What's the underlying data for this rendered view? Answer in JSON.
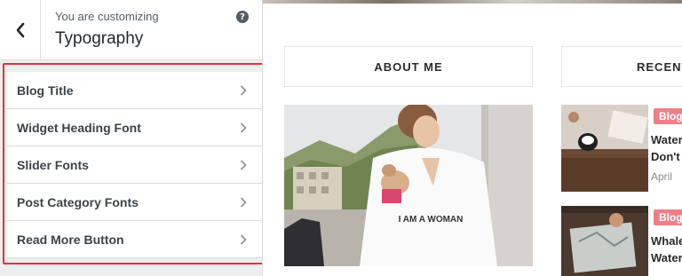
{
  "sidebar": {
    "customizing_label": "You are customizing",
    "section_title": "Typography",
    "help_symbol": "?",
    "items": [
      {
        "label": "Blog Title"
      },
      {
        "label": "Widget Heading Font"
      },
      {
        "label": "Slider Fonts"
      },
      {
        "label": "Post Category Fonts"
      },
      {
        "label": "Read More Button"
      }
    ]
  },
  "preview": {
    "about_me_title": "ABOUT ME",
    "about_photo_text": "I AM A WOMAN",
    "recent_title": "RECENT",
    "posts": [
      {
        "badge": "Blog",
        "title_line1": "Water",
        "title_line2": "Don't",
        "date": "April"
      },
      {
        "badge": "Blog",
        "title_line1": "Whale",
        "title_line2": "Water"
      }
    ]
  },
  "colors": {
    "highlight_border": "#e2303f",
    "badge": "#ef7f87",
    "sidebar_bg": "#eeeeee"
  }
}
